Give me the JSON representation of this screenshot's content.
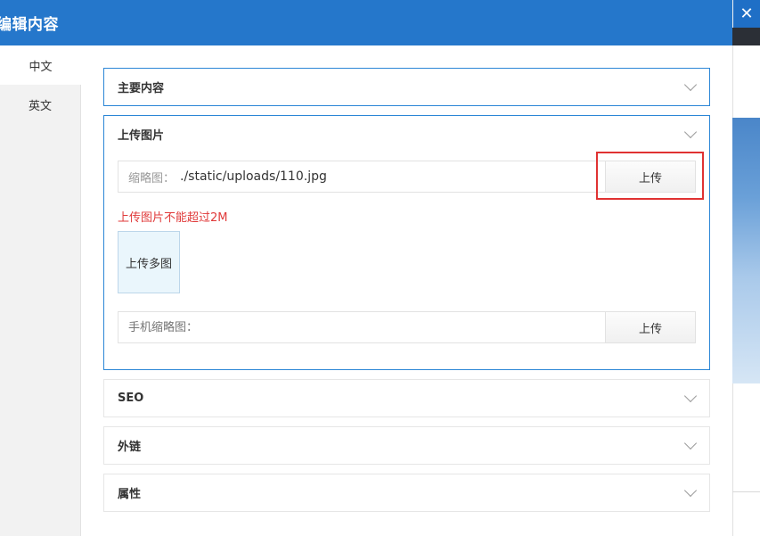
{
  "modal": {
    "title": "编辑内容",
    "close_glyph": "✕"
  },
  "sidebar": {
    "tabs": [
      {
        "label": "中文",
        "active": true
      },
      {
        "label": "英文",
        "active": false
      }
    ]
  },
  "panels": {
    "main_content": {
      "title": "主要内容"
    },
    "upload_images": {
      "title": "上传图片",
      "thumbnail": {
        "label": "缩略图：",
        "value": "./static/uploads/110.jpg",
        "button": "上传"
      },
      "warning": "上传图片不能超过2M",
      "multi_upload_button": "上传多图",
      "mobile_thumbnail": {
        "placeholder": "手机缩略图：",
        "value": "",
        "button": "上传"
      }
    },
    "seo": {
      "title": "SEO"
    },
    "external_links": {
      "title": "外链"
    },
    "attributes": {
      "title": "属性"
    }
  },
  "colors": {
    "header": "#2577cb",
    "active_panel_border": "#2b86d6",
    "warning": "#e03a3a",
    "highlight_box": "#e03232"
  },
  "icons": {
    "close": "close-icon",
    "collapse": "chevron-down-icon"
  }
}
